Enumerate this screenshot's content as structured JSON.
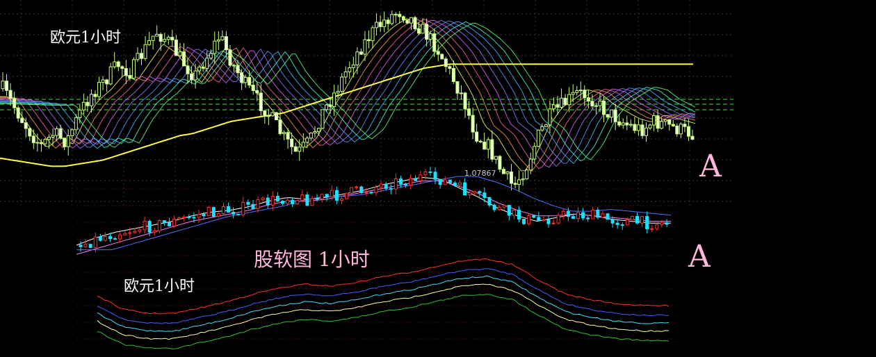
{
  "labels": {
    "top_left": "欧元1小时",
    "bottom_left": "欧元1小时",
    "center": "股软图  1小时",
    "marker_top": "A",
    "marker_bottom": "A",
    "price_high": "1.07867"
  },
  "colors": {
    "background": "#000000",
    "bull_candle": "#ff3030",
    "bear_candle": "#20e0ff",
    "mt_candle": "#c8ff80",
    "yellow_ma": "#ffff40",
    "label_pink": "#ffb6d9"
  },
  "chart_data": [
    {
      "type": "line",
      "title": "",
      "series": [
        {
          "name": "",
          "values": [
            0.62,
            0.52,
            0.42,
            0.34,
            0.4,
            0.36,
            0.5,
            0.6,
            0.66,
            0.74,
            0.7,
            0.8,
            0.9,
            0.85,
            0.76,
            0.68,
            0.78,
            0.88,
            0.74,
            0.64,
            0.56,
            0.48,
            0.38,
            0.3,
            0.36,
            0.5,
            0.6,
            0.72,
            0.82,
            0.9,
            0.96,
            1.0,
            0.96,
            0.9,
            0.82,
            0.7,
            0.58,
            0.4,
            0.34,
            0.22,
            0.14,
            0.24,
            0.4,
            0.5,
            0.55,
            0.6,
            0.58,
            0.52,
            0.48,
            0.44,
            0.42,
            0.46,
            0.44,
            0.42,
            0.4
          ]
        },
        {
          "name": "",
          "values": [
            0.28,
            0.27,
            0.26,
            0.25,
            0.24,
            0.24,
            0.25,
            0.26,
            0.27,
            0.29,
            0.31,
            0.33,
            0.35,
            0.37,
            0.39,
            0.4,
            0.42,
            0.44,
            0.46,
            0.47,
            0.48,
            0.49,
            0.5,
            0.52,
            0.54,
            0.56,
            0.58,
            0.6,
            0.62,
            0.64,
            0.66,
            0.68,
            0.7,
            0.72,
            0.73,
            0.74,
            0.74,
            0.74,
            0.74,
            0.74,
            0.74,
            0.74,
            0.74,
            0.74,
            0.74,
            0.74,
            0.74,
            0.74,
            0.74,
            0.74,
            0.74,
            0.74,
            0.74,
            0.74,
            0.74
          ]
        }
      ]
    },
    {
      "type": "line",
      "title": "",
      "series": [
        {
          "name": "",
          "values": [
            0.22,
            0.3,
            0.36,
            0.4,
            0.44,
            0.48,
            0.54,
            0.58,
            0.6,
            0.64,
            0.7,
            0.74,
            0.72,
            0.74,
            0.78,
            0.82,
            0.88,
            0.92,
            0.96,
            0.94,
            0.84,
            0.74,
            0.62,
            0.54,
            0.48,
            0.52,
            0.56,
            0.54,
            0.5,
            0.48,
            0.46,
            0.46
          ]
        },
        {
          "name": "",
          "values": [
            0.12,
            0.18,
            0.24,
            0.3,
            0.36,
            0.42,
            0.48,
            0.52,
            0.56,
            0.6,
            0.66,
            0.7,
            0.7,
            0.72,
            0.76,
            0.8,
            0.84,
            0.88,
            0.92,
            0.92,
            0.86,
            0.78,
            0.68,
            0.6,
            0.54,
            0.54,
            0.56,
            0.54,
            0.52,
            0.5,
            0.48,
            0.48
          ]
        }
      ]
    },
    {
      "type": "line",
      "title": "",
      "series": [
        {
          "name": "",
          "values": [
            0.6,
            0.46,
            0.42,
            0.42,
            0.48,
            0.54,
            0.62,
            0.68,
            0.72,
            0.7,
            0.74,
            0.8,
            0.84,
            0.9,
            0.96,
            0.98,
            0.92,
            0.76,
            0.62,
            0.56,
            0.52,
            0.5,
            0.5
          ]
        },
        {
          "name": "",
          "values": [
            0.5,
            0.36,
            0.32,
            0.32,
            0.38,
            0.44,
            0.52,
            0.58,
            0.62,
            0.6,
            0.64,
            0.7,
            0.74,
            0.8,
            0.86,
            0.88,
            0.82,
            0.66,
            0.52,
            0.46,
            0.42,
            0.4,
            0.4
          ]
        },
        {
          "name": "",
          "values": [
            0.42,
            0.28,
            0.24,
            0.24,
            0.3,
            0.36,
            0.44,
            0.5,
            0.54,
            0.52,
            0.56,
            0.62,
            0.66,
            0.72,
            0.78,
            0.8,
            0.74,
            0.58,
            0.44,
            0.38,
            0.34,
            0.32,
            0.32
          ]
        },
        {
          "name": "",
          "values": [
            0.34,
            0.2,
            0.16,
            0.16,
            0.22,
            0.28,
            0.36,
            0.42,
            0.46,
            0.44,
            0.48,
            0.54,
            0.58,
            0.64,
            0.7,
            0.72,
            0.66,
            0.5,
            0.36,
            0.3,
            0.26,
            0.24,
            0.24
          ]
        },
        {
          "name": "",
          "values": [
            0.24,
            0.1,
            0.06,
            0.06,
            0.12,
            0.18,
            0.26,
            0.32,
            0.36,
            0.34,
            0.38,
            0.44,
            0.48,
            0.54,
            0.6,
            0.62,
            0.56,
            0.4,
            0.26,
            0.2,
            0.16,
            0.14,
            0.14
          ]
        }
      ]
    }
  ]
}
